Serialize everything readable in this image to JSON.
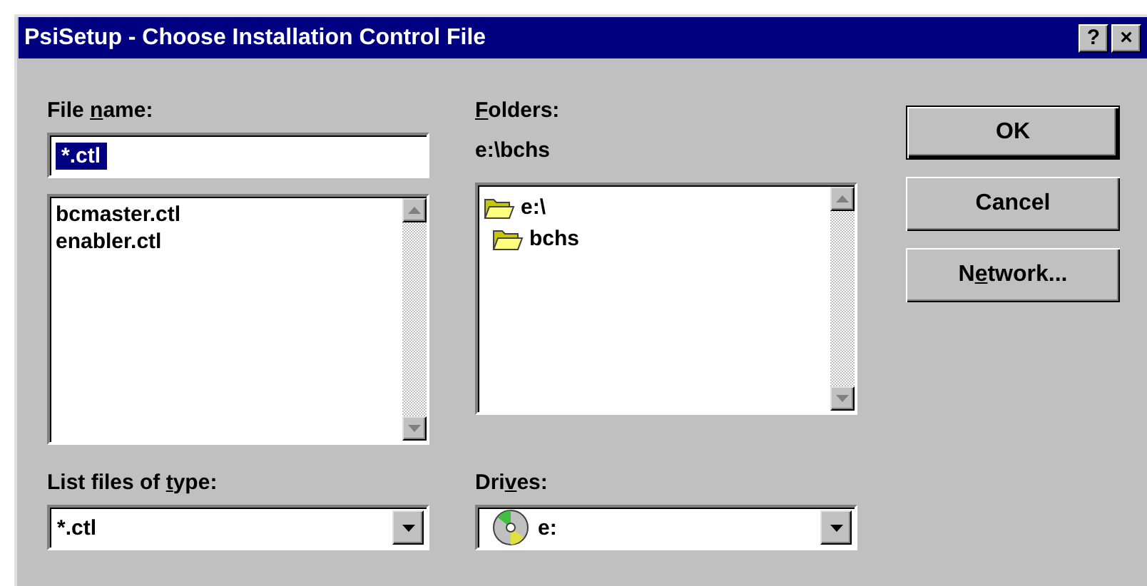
{
  "window": {
    "title": "PsiSetup - Choose Installation Control File",
    "title_buttons": [
      "?",
      "×"
    ]
  },
  "file_name": {
    "label": {
      "before": "File ",
      "key": "n",
      "after": "ame:"
    },
    "value": "*.ctl",
    "selected": true
  },
  "files": [
    "bcmaster.ctl",
    "enabler.ctl"
  ],
  "folders_label": {
    "key": "F",
    "after": "olders:"
  },
  "current_path": "e:\\bchs",
  "folders": [
    {
      "label": "e:\\",
      "children": [
        {
          "label": "bchs"
        }
      ]
    }
  ],
  "file_type": {
    "label": {
      "before": "List files of ",
      "key": "t",
      "after": "ype:"
    },
    "value": "*.ctl"
  },
  "drives": {
    "label": {
      "before": "Dri",
      "key": "v",
      "after": "es:"
    },
    "value": "e:"
  },
  "buttons": [
    {
      "label": {
        "before": "OK"
      },
      "default": true
    },
    {
      "label": {
        "before": "Cancel"
      },
      "default": false
    },
    {
      "label": {
        "before": "N",
        "key": "e",
        "after": "twork..."
      },
      "default": false
    }
  ]
}
